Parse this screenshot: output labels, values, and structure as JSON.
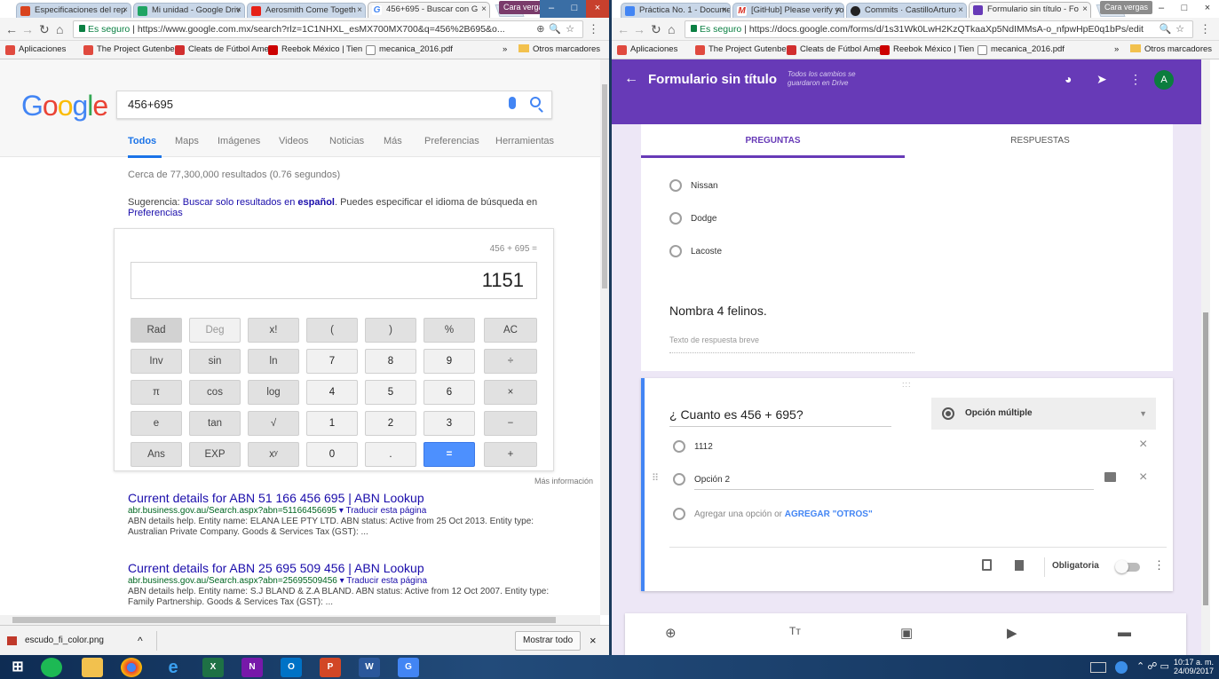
{
  "left_window": {
    "tabs": [
      {
        "label": "Especificaciones del rep",
        "color": "#d9431e"
      },
      {
        "label": "Mi unidad - Google Driv",
        "color": "#1fa463"
      },
      {
        "label": "Aerosmith Come Togeth",
        "color": "#e62117"
      },
      {
        "label": "456+695 - Buscar con G",
        "color": "#4285f4"
      }
    ],
    "profile": "Cara vergas",
    "url_secure": "Es seguro",
    "url": "https://www.google.com.mx/search?rlz=1C1NHXL_esMX700MX700&q=456%2B695&o...",
    "bookmarks": [
      {
        "label": "Aplicaciones",
        "color": "#e04a3f"
      },
      {
        "label": "The Project Gutenber",
        "color": "#e04a3f"
      },
      {
        "label": "Cleats de Fútbol Amer",
        "color": "#d12e2e"
      },
      {
        "label": "Reebok México | Tien",
        "color": "#cc0000"
      },
      {
        "label": "mecanica_2016.pdf",
        "color": "#888888"
      }
    ],
    "more_bookmarks": "»",
    "other_bookmarks": "Otros marcadores"
  },
  "google": {
    "logo": "Google",
    "query": "456+695",
    "tabs": [
      "Todos",
      "Maps",
      "Imágenes",
      "Videos",
      "Noticias",
      "Más",
      "Preferencias",
      "Herramientas"
    ],
    "stats": "Cerca de 77,300,000 resultados (0.76 segundos)",
    "suggestion": {
      "prefix": "Sugerencia: ",
      "link": "Buscar solo resultados en",
      "bold": "español",
      "suffix": ". Puedes especificar el idioma de búsqueda en",
      "link2": "Preferencias"
    },
    "calc": {
      "expression": "456 + 695 =",
      "display": "1151",
      "rows": [
        [
          "Rad",
          "Deg",
          "x!",
          "(",
          ")",
          "%",
          "AC"
        ],
        [
          "Inv",
          "sin",
          "ln",
          "7",
          "8",
          "9",
          "÷"
        ],
        [
          "π",
          "cos",
          "log",
          "4",
          "5",
          "6",
          "×"
        ],
        [
          "e",
          "tan",
          "√",
          "1",
          "2",
          "3",
          "−"
        ],
        [
          "Ans",
          "EXP",
          "xʸ",
          "0",
          ".",
          "=",
          "+"
        ]
      ],
      "more": "Más información"
    },
    "results": [
      {
        "title": "Current details for ABN 51 166 456 695 | ABN Lookup",
        "url": "abr.business.gov.au/Search.aspx?abn=51166456695",
        "translate": "▾ Traducir esta página",
        "snippet": "ABN details help. Entity name: ELANA LEE PTY LTD. ABN status: Active from 25 Oct 2013. Entity type: Australian Private Company. Goods & Services Tax (GST): ..."
      },
      {
        "title": "Current details for ABN 25 695 509 456 | ABN Lookup",
        "url": "abr.business.gov.au/Search.aspx?abn=25695509456",
        "translate": "▾ Traducir esta página",
        "snippet": "ABN details help. Entity name: S.J BLAND & Z.A BLAND. ABN status: Active from 12 Oct 2007. Entity type: Family Partnership. Goods & Services Tax (GST): ..."
      }
    ],
    "download": {
      "file": "escudo_fi_color.png",
      "show_all": "Mostrar todo"
    }
  },
  "right_window": {
    "tabs": [
      {
        "label": "Práctica No. 1 - Docume",
        "color": "#4285f4"
      },
      {
        "label": "[GitHub] Please verify yo",
        "color": "#d93025"
      },
      {
        "label": "Commits · CastilloArturo",
        "color": "#222222"
      },
      {
        "label": "Formulario sin título - Fo",
        "color": "#673ab7"
      }
    ],
    "profile": "Cara vergas",
    "url_secure": "Es seguro",
    "url": "https://docs.google.com/forms/d/1s31Wk0LwH2KzQTkaaXp5NdIMMsA-o_nfpwHpE0q1bPs/edit",
    "bookmarks": [
      {
        "label": "Aplicaciones",
        "color": "#e04a3f"
      },
      {
        "label": "The Project Gutenber",
        "color": "#e04a3f"
      },
      {
        "label": "Cleats de Fútbol Amer",
        "color": "#d12e2e"
      },
      {
        "label": "Reebok México | Tien",
        "color": "#cc0000"
      },
      {
        "label": "mecanica_2016.pdf",
        "color": "#888888"
      }
    ],
    "more_bookmarks": "»",
    "other_bookmarks": "Otros marcadores"
  },
  "form": {
    "title": "Formulario sin título",
    "saved": "Todos los cambios se guardaron en Drive",
    "avatar": "A",
    "tabs": [
      "PREGUNTAS",
      "RESPUESTAS"
    ],
    "prev_options": [
      "Nissan",
      "Dodge",
      "Lacoste"
    ],
    "q2_title": "Nombra 4 felinos.",
    "q2_placeholder": "Texto de respuesta breve",
    "q3_title": "¿ Cuanto es 456 + 695?",
    "q3_type": "Opción múltiple",
    "q3_options": [
      "1112",
      "Opción 2"
    ],
    "add_option": "Agregar una opción",
    "or": "or",
    "add_other": "AGREGAR \"OTROS\"",
    "required": "Obligatoria",
    "accent": "#673ab7"
  },
  "taskbar": {
    "apps": [
      "Start",
      "Spotify",
      "Explorer",
      "Chrome",
      "Edge",
      "Excel",
      "OneNote",
      "Outlook",
      "PowerPoint",
      "Word",
      "Chrome"
    ],
    "time": "10:17 a. m.",
    "date": "24/09/2017"
  }
}
